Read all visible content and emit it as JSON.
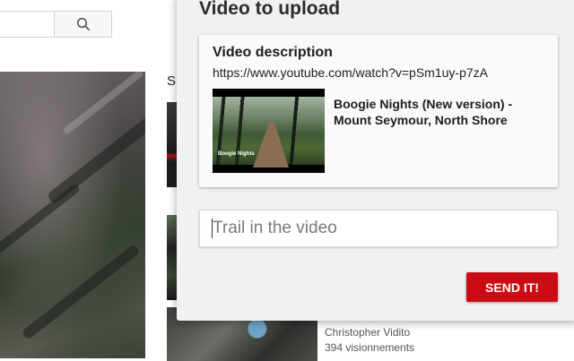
{
  "background": {
    "up_next_label": "Su",
    "side_video": {
      "channel": "Christopher Vidito",
      "views": "394 visionnements"
    },
    "icons": {
      "search": "search-icon"
    }
  },
  "popup": {
    "title": "Video to upload",
    "card": {
      "heading": "Video description",
      "url": "https://www.youtube.com/watch?v=pSm1uy-p7zA",
      "video_title": "Boogie Nights (New version) - Mount Seymour, North Shore",
      "thumb_logo_text": "Boogie Nights"
    },
    "trail_input": {
      "value": "",
      "placeholder": "Trail in the video"
    },
    "send_label": "SEND IT!"
  },
  "colors": {
    "accent": "#cc0c15",
    "popup_bg": "#f1f1f1"
  }
}
